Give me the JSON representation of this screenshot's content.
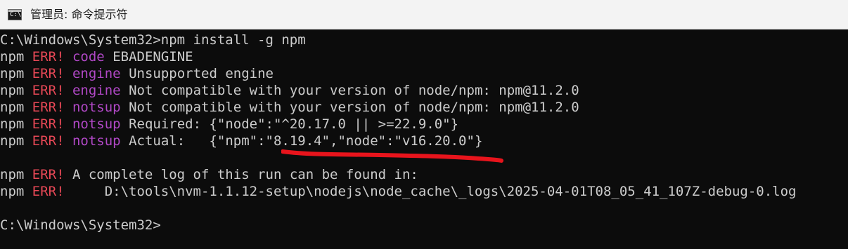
{
  "window": {
    "title": "管理员: 命令提示符",
    "icon": "cmd-icon",
    "icon_glyph": "C:\\"
  },
  "console": {
    "lines": [
      {
        "segments": [
          {
            "text": "C:\\Windows\\System32>npm install -g npm",
            "style": "plain"
          }
        ]
      },
      {
        "segments": [
          {
            "text": "npm ",
            "style": "plain"
          },
          {
            "text": "ERR!",
            "style": "err"
          },
          {
            "text": " ",
            "style": "plain"
          },
          {
            "text": "code",
            "style": "kw"
          },
          {
            "text": " EBADENGINE",
            "style": "plain"
          }
        ]
      },
      {
        "segments": [
          {
            "text": "npm ",
            "style": "plain"
          },
          {
            "text": "ERR!",
            "style": "err"
          },
          {
            "text": " ",
            "style": "plain"
          },
          {
            "text": "engine",
            "style": "kw"
          },
          {
            "text": " Unsupported engine",
            "style": "plain"
          }
        ]
      },
      {
        "segments": [
          {
            "text": "npm ",
            "style": "plain"
          },
          {
            "text": "ERR!",
            "style": "err"
          },
          {
            "text": " ",
            "style": "plain"
          },
          {
            "text": "engine",
            "style": "kw"
          },
          {
            "text": " Not compatible with your version of node/npm: npm@11.2.0",
            "style": "plain"
          }
        ]
      },
      {
        "segments": [
          {
            "text": "npm ",
            "style": "plain"
          },
          {
            "text": "ERR!",
            "style": "err"
          },
          {
            "text": " ",
            "style": "plain"
          },
          {
            "text": "notsup",
            "style": "kw"
          },
          {
            "text": " Not compatible with your version of node/npm: npm@11.2.0",
            "style": "plain"
          }
        ]
      },
      {
        "segments": [
          {
            "text": "npm ",
            "style": "plain"
          },
          {
            "text": "ERR!",
            "style": "err"
          },
          {
            "text": " ",
            "style": "plain"
          },
          {
            "text": "notsup",
            "style": "kw"
          },
          {
            "text": " Required: {\"node\":\"^20.17.0 || >=22.9.0\"}",
            "style": "plain"
          }
        ]
      },
      {
        "segments": [
          {
            "text": "npm ",
            "style": "plain"
          },
          {
            "text": "ERR!",
            "style": "err"
          },
          {
            "text": " ",
            "style": "plain"
          },
          {
            "text": "notsup",
            "style": "kw"
          },
          {
            "text": " Actual:   {\"npm\":\"8.19.4\",\"node\":\"v16.20.0\"}",
            "style": "plain"
          }
        ]
      },
      {
        "segments": [
          {
            "text": "",
            "style": "plain"
          }
        ]
      },
      {
        "segments": [
          {
            "text": "npm ",
            "style": "plain"
          },
          {
            "text": "ERR!",
            "style": "err"
          },
          {
            "text": " A complete log of this run can be found in:",
            "style": "plain"
          }
        ]
      },
      {
        "segments": [
          {
            "text": "npm ",
            "style": "plain"
          },
          {
            "text": "ERR!",
            "style": "err"
          },
          {
            "text": "     D:\\tools\\nvm-1.1.12-setup\\nodejs\\node_cache\\_logs\\2025-04-01T08_05_41_107Z-debug-0.log",
            "style": "plain"
          }
        ]
      },
      {
        "segments": [
          {
            "text": "",
            "style": "plain"
          }
        ]
      },
      {
        "segments": [
          {
            "text": "C:\\Windows\\System32>",
            "style": "plain"
          }
        ]
      }
    ]
  },
  "annotation": {
    "kind": "hand-drawn underline",
    "color": "#e8141c"
  }
}
